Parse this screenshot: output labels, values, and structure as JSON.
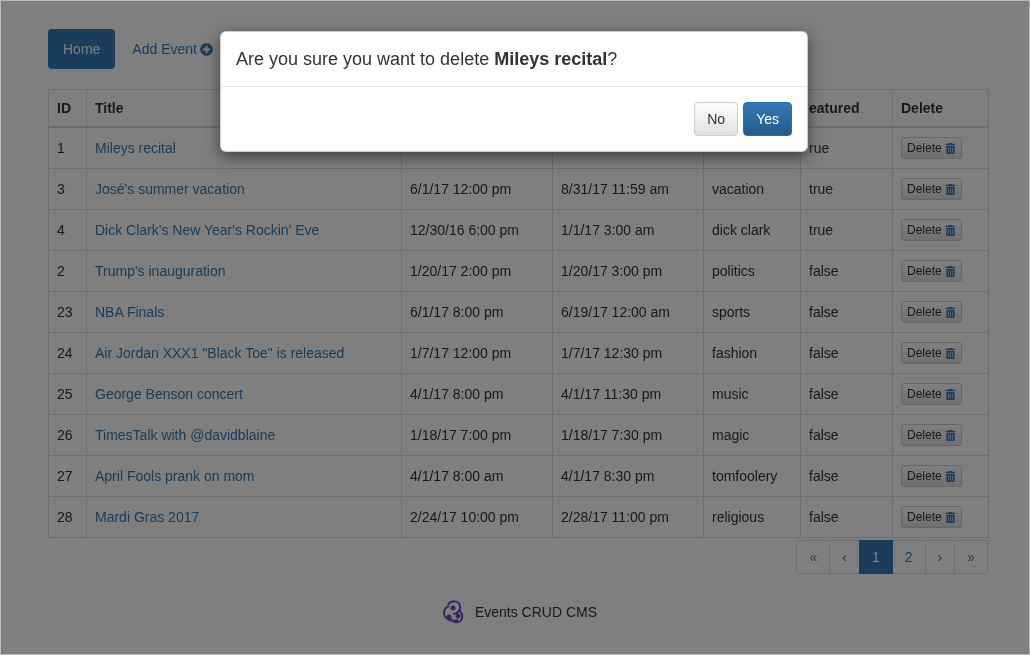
{
  "nav": [
    {
      "label": "Home",
      "selected": true,
      "kind": "plain"
    },
    {
      "label": "Add Event",
      "selected": false,
      "kind": "add"
    }
  ],
  "table": {
    "columns": {
      "id": "ID",
      "title": "Title",
      "featured": "eatured",
      "delete": "Delete"
    },
    "rows": [
      {
        "id": "1",
        "title": "Mileys recital",
        "featured": "rue",
        "delete": "Delete"
      },
      {
        "id": "3",
        "title": "José's summer vacation",
        "column_3": "6/1/17 12:00 pm",
        "column_4": "8/31/17 11:59 am",
        "column_5": "vacation",
        "featured": "true",
        "delete": "Delete"
      },
      {
        "id": "4",
        "title": "Dick Clark's New Year's Rockin' Eve",
        "column_3": "12/30/16 6:00 pm",
        "column_4": "1/1/17 3:00 am",
        "column_5": "dick clark",
        "featured": "true",
        "delete": "Delete"
      },
      {
        "id": "2",
        "title": "Trump's inauguration",
        "column_3": "1/20/17 2:00 pm",
        "column_4": "1/20/17 3:00 pm",
        "column_5": "politics",
        "featured": "false",
        "delete": "Delete"
      },
      {
        "id": "23",
        "title": "NBA Finals",
        "column_3": "6/1/17 8:00 pm",
        "column_4": "6/19/17 12:00 am",
        "column_5": "sports",
        "featured": "false",
        "delete": "Delete"
      },
      {
        "id": "24",
        "title": "Air Jordan XXX1 \"Black Toe\" is released",
        "column_3": "1/7/17 12:00 pm",
        "column_4": "1/7/17 12:30 pm",
        "column_5": "fashion",
        "featured": "false",
        "delete": "Delete"
      },
      {
        "id": "25",
        "title": "George Benson concert",
        "column_3": "4/1/17 8:00 pm",
        "column_4": "4/1/17 11:30 pm",
        "column_5": "music",
        "featured": "false",
        "delete": "Delete"
      },
      {
        "id": "26",
        "title": "TimesTalk with @davidblaine",
        "column_3": "1/18/17 7:00 pm",
        "column_4": "1/18/17 7:30 pm",
        "column_5": "magic",
        "featured": "false",
        "delete": "Delete"
      },
      {
        "id": "27",
        "title": "April Fools prank on mom",
        "column_3": "4/1/17 8:00 am",
        "column_4": "4/1/17 8:30 pm",
        "column_5": "tomfoolery",
        "featured": "false",
        "delete": "Delete"
      },
      {
        "id": "28",
        "title": "Mardi Gras 2017",
        "column_3": "2/24/17 10:00 pm",
        "column_4": "2/28/17 11:00 pm",
        "column_5": "religious",
        "featured": "false",
        "delete": "Delete"
      }
    ]
  },
  "pagination": [
    {
      "label": "«",
      "selected": false
    },
    {
      "label": "‹",
      "selected": false
    },
    {
      "label": "1",
      "selected": true
    },
    {
      "label": "2",
      "selected": false
    },
    {
      "label": "›",
      "selected": false
    },
    {
      "label": "»",
      "selected": false
    }
  ],
  "footer": {
    "text": "Events CRUD CMS"
  },
  "dialog": {
    "message": "Are you sure you want to delete **Mileys recital**?",
    "buttons": [
      {
        "label": "No",
        "kind": "default"
      },
      {
        "label": "Yes",
        "kind": "primary"
      }
    ]
  }
}
